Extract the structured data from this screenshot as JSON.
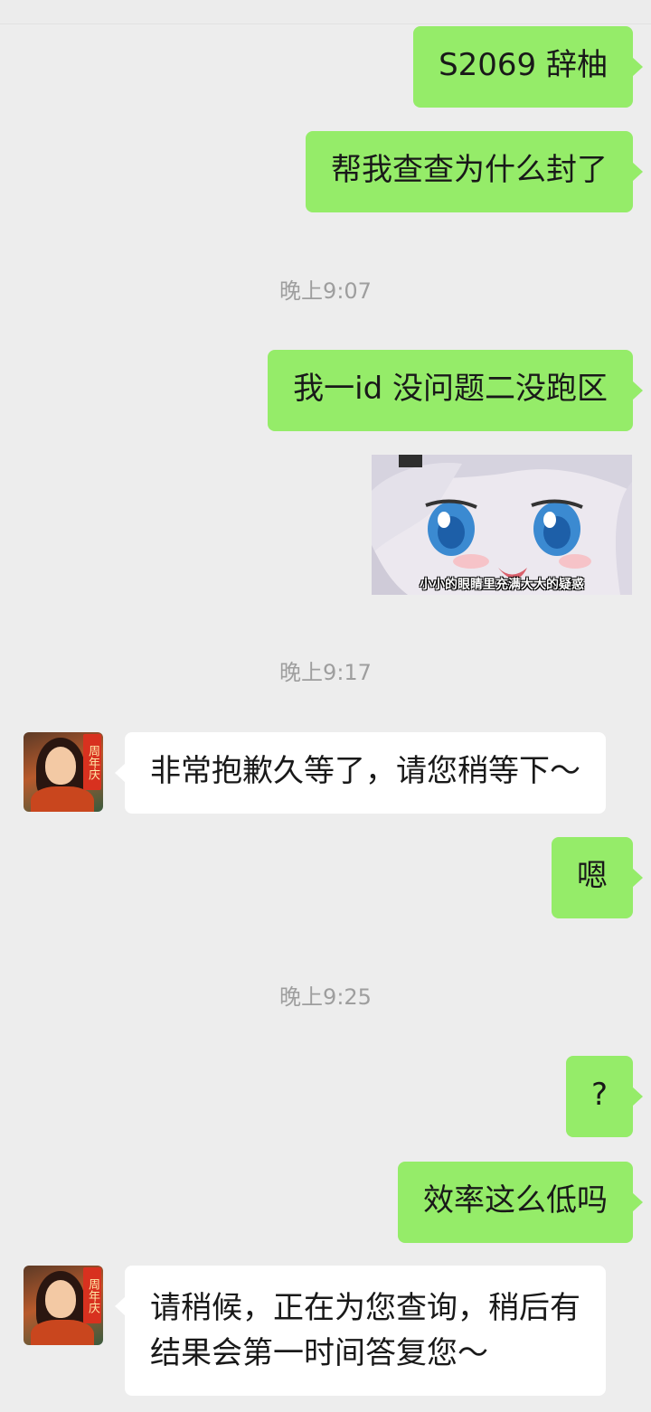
{
  "messages": [
    {
      "side": "out",
      "text": "S2069 辞柚"
    },
    {
      "side": "out",
      "text": "帮我查查为什么封了"
    },
    {
      "side": "out",
      "text": "我一id 没问题二没跑区"
    },
    {
      "side": "out",
      "type": "sticker",
      "caption": "小小的眼睛里充满大大的疑惑"
    },
    {
      "side": "in",
      "text": "非常抱歉久等了，请您稍等下～"
    },
    {
      "side": "out",
      "text": "嗯"
    },
    {
      "side": "out",
      "text": "?"
    },
    {
      "side": "out",
      "text": "效率这么低吗"
    },
    {
      "side": "in",
      "lines": [
        "请稍候，正在为您查询，稍后有",
        "结果会第一时间答复您～"
      ]
    }
  ],
  "timestamps": [
    "晚上9:07",
    "晚上9:17",
    "晚上9:25"
  ],
  "avatar_badge": "周年庆",
  "colors": {
    "background": "#ededed",
    "outgoing_bubble": "#95ec69",
    "incoming_bubble": "#ffffff",
    "timestamp_text": "#9e9e9e"
  }
}
